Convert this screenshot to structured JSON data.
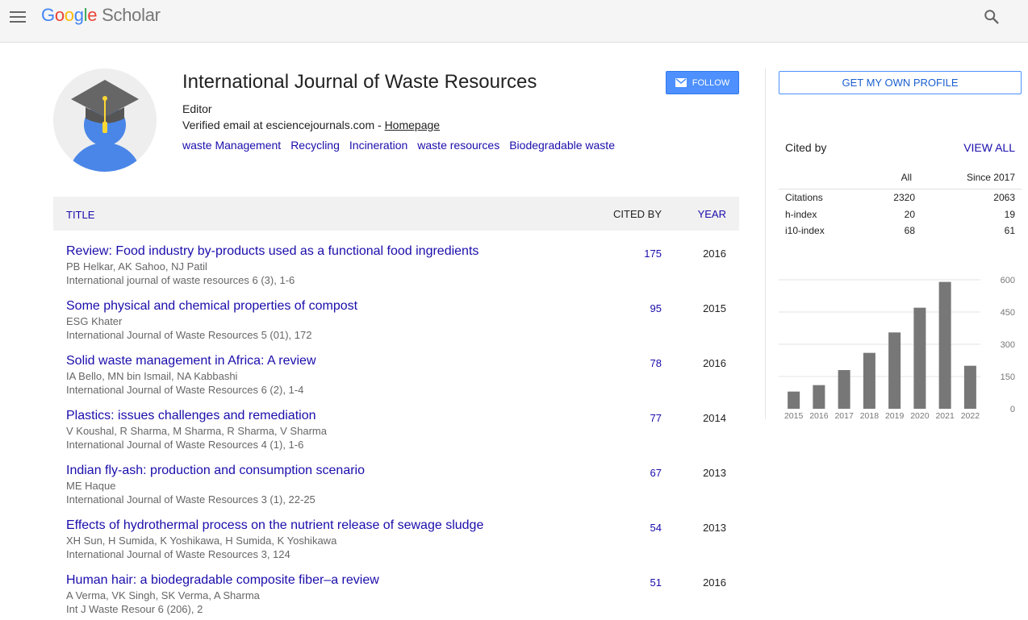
{
  "header": {
    "logo_letters": [
      "G",
      "o",
      "o",
      "g",
      "l",
      "e"
    ],
    "logo_suffix": "Scholar"
  },
  "profile": {
    "name": "International Journal of Waste Resources",
    "affiliation": "Editor",
    "email_text": "Verified email at esciencejournals.com - ",
    "homepage_label": "Homepage",
    "follow_label": "FOLLOW",
    "interests": [
      "waste Management",
      "Recycling",
      "Incineration",
      "waste resources",
      "Biodegradable waste"
    ]
  },
  "table": {
    "col_title": "TITLE",
    "col_cited": "CITED BY",
    "col_year": "YEAR",
    "rows": [
      {
        "title": "Review: Food industry by-products used as a functional food ingredients",
        "authors": "PB Helkar, AK Sahoo, NJ Patil",
        "venue": "International journal of waste resources 6 (3), 1-6",
        "cited": "175",
        "year": "2016"
      },
      {
        "title": "Some physical and chemical properties of compost",
        "authors": "ESG Khater",
        "venue": "International Journal of Waste Resources 5 (01), 172",
        "cited": "95",
        "year": "2015"
      },
      {
        "title": "Solid waste management in Africa: A review",
        "authors": "IA Bello, MN bin Ismail, NA Kabbashi",
        "venue": "International Journal of Waste Resources 6 (2), 1-4",
        "cited": "78",
        "year": "2016"
      },
      {
        "title": "Plastics: issues challenges and remediation",
        "authors": "V Koushal, R Sharma, M Sharma, R Sharma, V Sharma",
        "venue": "International Journal of Waste Resources 4 (1), 1-6",
        "cited": "77",
        "year": "2014"
      },
      {
        "title": "Indian fly-ash: production and consumption scenario",
        "authors": "ME Haque",
        "venue": "International Journal of Waste Resources 3 (1), 22-25",
        "cited": "67",
        "year": "2013"
      },
      {
        "title": "Effects of hydrothermal process on the nutrient release of sewage sludge",
        "authors": "XH Sun, H Sumida, K Yoshikawa, H Sumida, K Yoshikawa",
        "venue": "International Journal of Waste Resources 3, 124",
        "cited": "54",
        "year": "2013"
      },
      {
        "title": "Human hair: a biodegradable composite fiber–a review",
        "authors": "A Verma, VK Singh, SK Verma, A Sharma",
        "venue": "Int J Waste Resour 6 (206), 2",
        "cited": "51",
        "year": "2016"
      }
    ]
  },
  "sidebar": {
    "get_profile_label": "GET MY OWN PROFILE",
    "cited_by_label": "Cited by",
    "view_all_label": "VIEW ALL",
    "stats_headers": [
      "All",
      "Since 2017"
    ],
    "stats": [
      {
        "label": "Citations",
        "all": "2320",
        "since": "2063"
      },
      {
        "label": "h-index",
        "all": "20",
        "since": "19"
      },
      {
        "label": "i10-index",
        "all": "68",
        "since": "61"
      }
    ]
  },
  "chart_data": {
    "type": "bar",
    "categories": [
      "2015",
      "2016",
      "2017",
      "2018",
      "2019",
      "2020",
      "2021",
      "2022"
    ],
    "values": [
      80,
      110,
      180,
      260,
      355,
      470,
      590,
      200
    ],
    "ylim": [
      0,
      600
    ],
    "yticks": [
      "600",
      "450",
      "300",
      "150",
      "0"
    ],
    "bar_color": "#777777"
  }
}
